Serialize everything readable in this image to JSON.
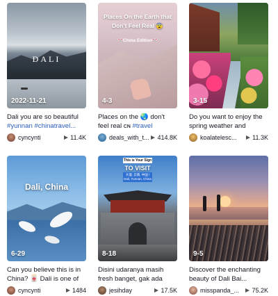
{
  "cards": [
    {
      "date": "2022-11-21",
      "overlay": "DALI",
      "overlay_sub": "",
      "caption_text": "Dali you are so beautiful ",
      "caption_tags": "#yunnan #chinatravel...",
      "author": "cyncynti",
      "views": "11.4K"
    },
    {
      "date": "4-3",
      "overlay": "Places On the Earth that Don't Feel Real 😨",
      "overlay_sub": "🎌China Edition🎌",
      "caption_text": "Places on the 🌏 don't feel real ᴄɴ ",
      "caption_tags": "#travel #China...",
      "author": "deals_with_t...",
      "views": "414.8K"
    },
    {
      "date": "3-15",
      "overlay": "",
      "overlay_sub": "",
      "caption_text": "Do you want to enjoy the spring weather and flowers...",
      "caption_tags": "",
      "author": "koalatelesc...",
      "views": "11.3K"
    },
    {
      "date": "6-29",
      "overlay": "Dali, China",
      "overlay_sub": "",
      "caption_text": "Can you believe this is in China? 🀄 Dali is one of those...",
      "caption_tags": "",
      "author": "cyncynti",
      "views": "1484"
    },
    {
      "date": "8-18",
      "overlay": "This is Your Sign",
      "overlay_sub": "TO VISIT",
      "overlay_sub2": "大理, 云南, 中国 / Dali, Yunnan, China",
      "caption_text": "Disini udaranya masih fresh banget, gak ada gedung...",
      "caption_tags": "",
      "author": "jesihday",
      "views": "17.5K"
    },
    {
      "date": "9-5",
      "overlay": "",
      "overlay_sub": "",
      "caption_text": "Discover the enchanting beauty of Dali Bai...",
      "caption_tags": "",
      "author": "misspanda_...",
      "views": "75.2K"
    }
  ]
}
